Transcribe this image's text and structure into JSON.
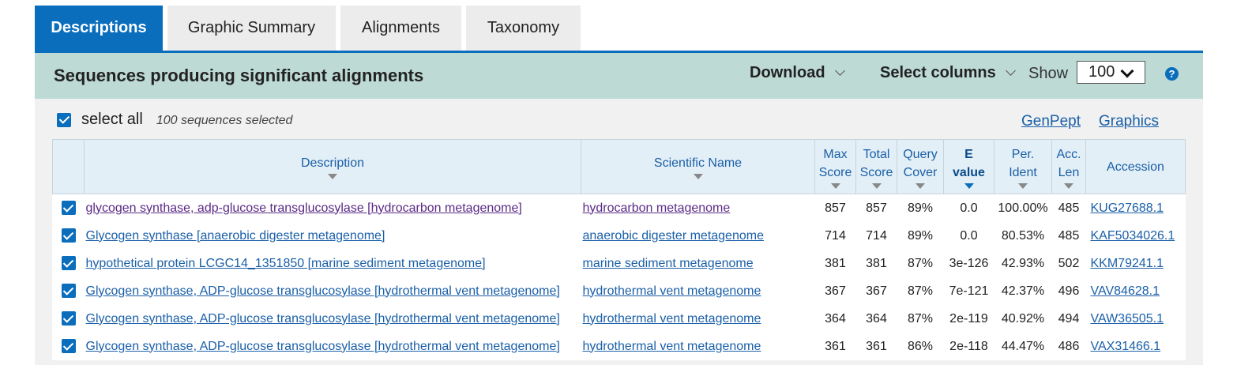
{
  "tabs": [
    "Descriptions",
    "Graphic Summary",
    "Alignments",
    "Taxonomy"
  ],
  "toolbar": {
    "title": "Sequences producing significant alignments",
    "download_label": "Download",
    "select_columns_label": "Select columns",
    "show_label": "Show",
    "show_value": "100",
    "help_glyph": "?"
  },
  "selection": {
    "select_all_label": "select all",
    "count_text": "100 sequences selected",
    "genpept_label": "GenPept",
    "graphics_label": "Graphics"
  },
  "columns": {
    "description": "Description",
    "scientific_name": "Scientific Name",
    "max_score": [
      "Max",
      "Score"
    ],
    "total_score": [
      "Total",
      "Score"
    ],
    "query_cover": [
      "Query",
      "Cover"
    ],
    "e_value": [
      "E",
      "value"
    ],
    "per_ident": [
      "Per.",
      "Ident"
    ],
    "acc_len": [
      "Acc.",
      "Len"
    ],
    "accession": "Accession"
  },
  "rows": [
    {
      "description": "glycogen synthase, adp-glucose transglucosylase [hydrocarbon metagenome]",
      "scientific_name": "hydrocarbon metagenome",
      "max_score": "857",
      "total_score": "857",
      "query_cover": "89%",
      "e_value": "0.0",
      "per_ident": "100.00%",
      "acc_len": "485",
      "accession": "KUG27688.1"
    },
    {
      "description": "Glycogen synthase [anaerobic digester metagenome]",
      "scientific_name": "anaerobic digester metagenome",
      "max_score": "714",
      "total_score": "714",
      "query_cover": "89%",
      "e_value": "0.0",
      "per_ident": "80.53%",
      "acc_len": "485",
      "accession": "KAF5034026.1"
    },
    {
      "description": "hypothetical protein LCGC14_1351850 [marine sediment metagenome]",
      "scientific_name": "marine sediment metagenome",
      "max_score": "381",
      "total_score": "381",
      "query_cover": "87%",
      "e_value": "3e-126",
      "per_ident": "42.93%",
      "acc_len": "502",
      "accession": "KKM79241.1"
    },
    {
      "description": "Glycogen synthase, ADP-glucose transglucosylase [hydrothermal vent metagenome]",
      "scientific_name": "hydrothermal vent metagenome",
      "max_score": "367",
      "total_score": "367",
      "query_cover": "87%",
      "e_value": "7e-121",
      "per_ident": "42.37%",
      "acc_len": "496",
      "accession": "VAV84628.1"
    },
    {
      "description": "Glycogen synthase, ADP-glucose transglucosylase [hydrothermal vent metagenome]",
      "scientific_name": "hydrothermal vent metagenome",
      "max_score": "364",
      "total_score": "364",
      "query_cover": "87%",
      "e_value": "2e-119",
      "per_ident": "40.92%",
      "acc_len": "494",
      "accession": "VAW36505.1"
    },
    {
      "description": "Glycogen synthase, ADP-glucose transglucosylase [hydrothermal vent metagenome]",
      "scientific_name": "hydrothermal vent metagenome",
      "max_score": "361",
      "total_score": "361",
      "query_cover": "86%",
      "e_value": "2e-118",
      "per_ident": "44.47%",
      "acc_len": "486",
      "accession": "VAX31466.1"
    }
  ]
}
